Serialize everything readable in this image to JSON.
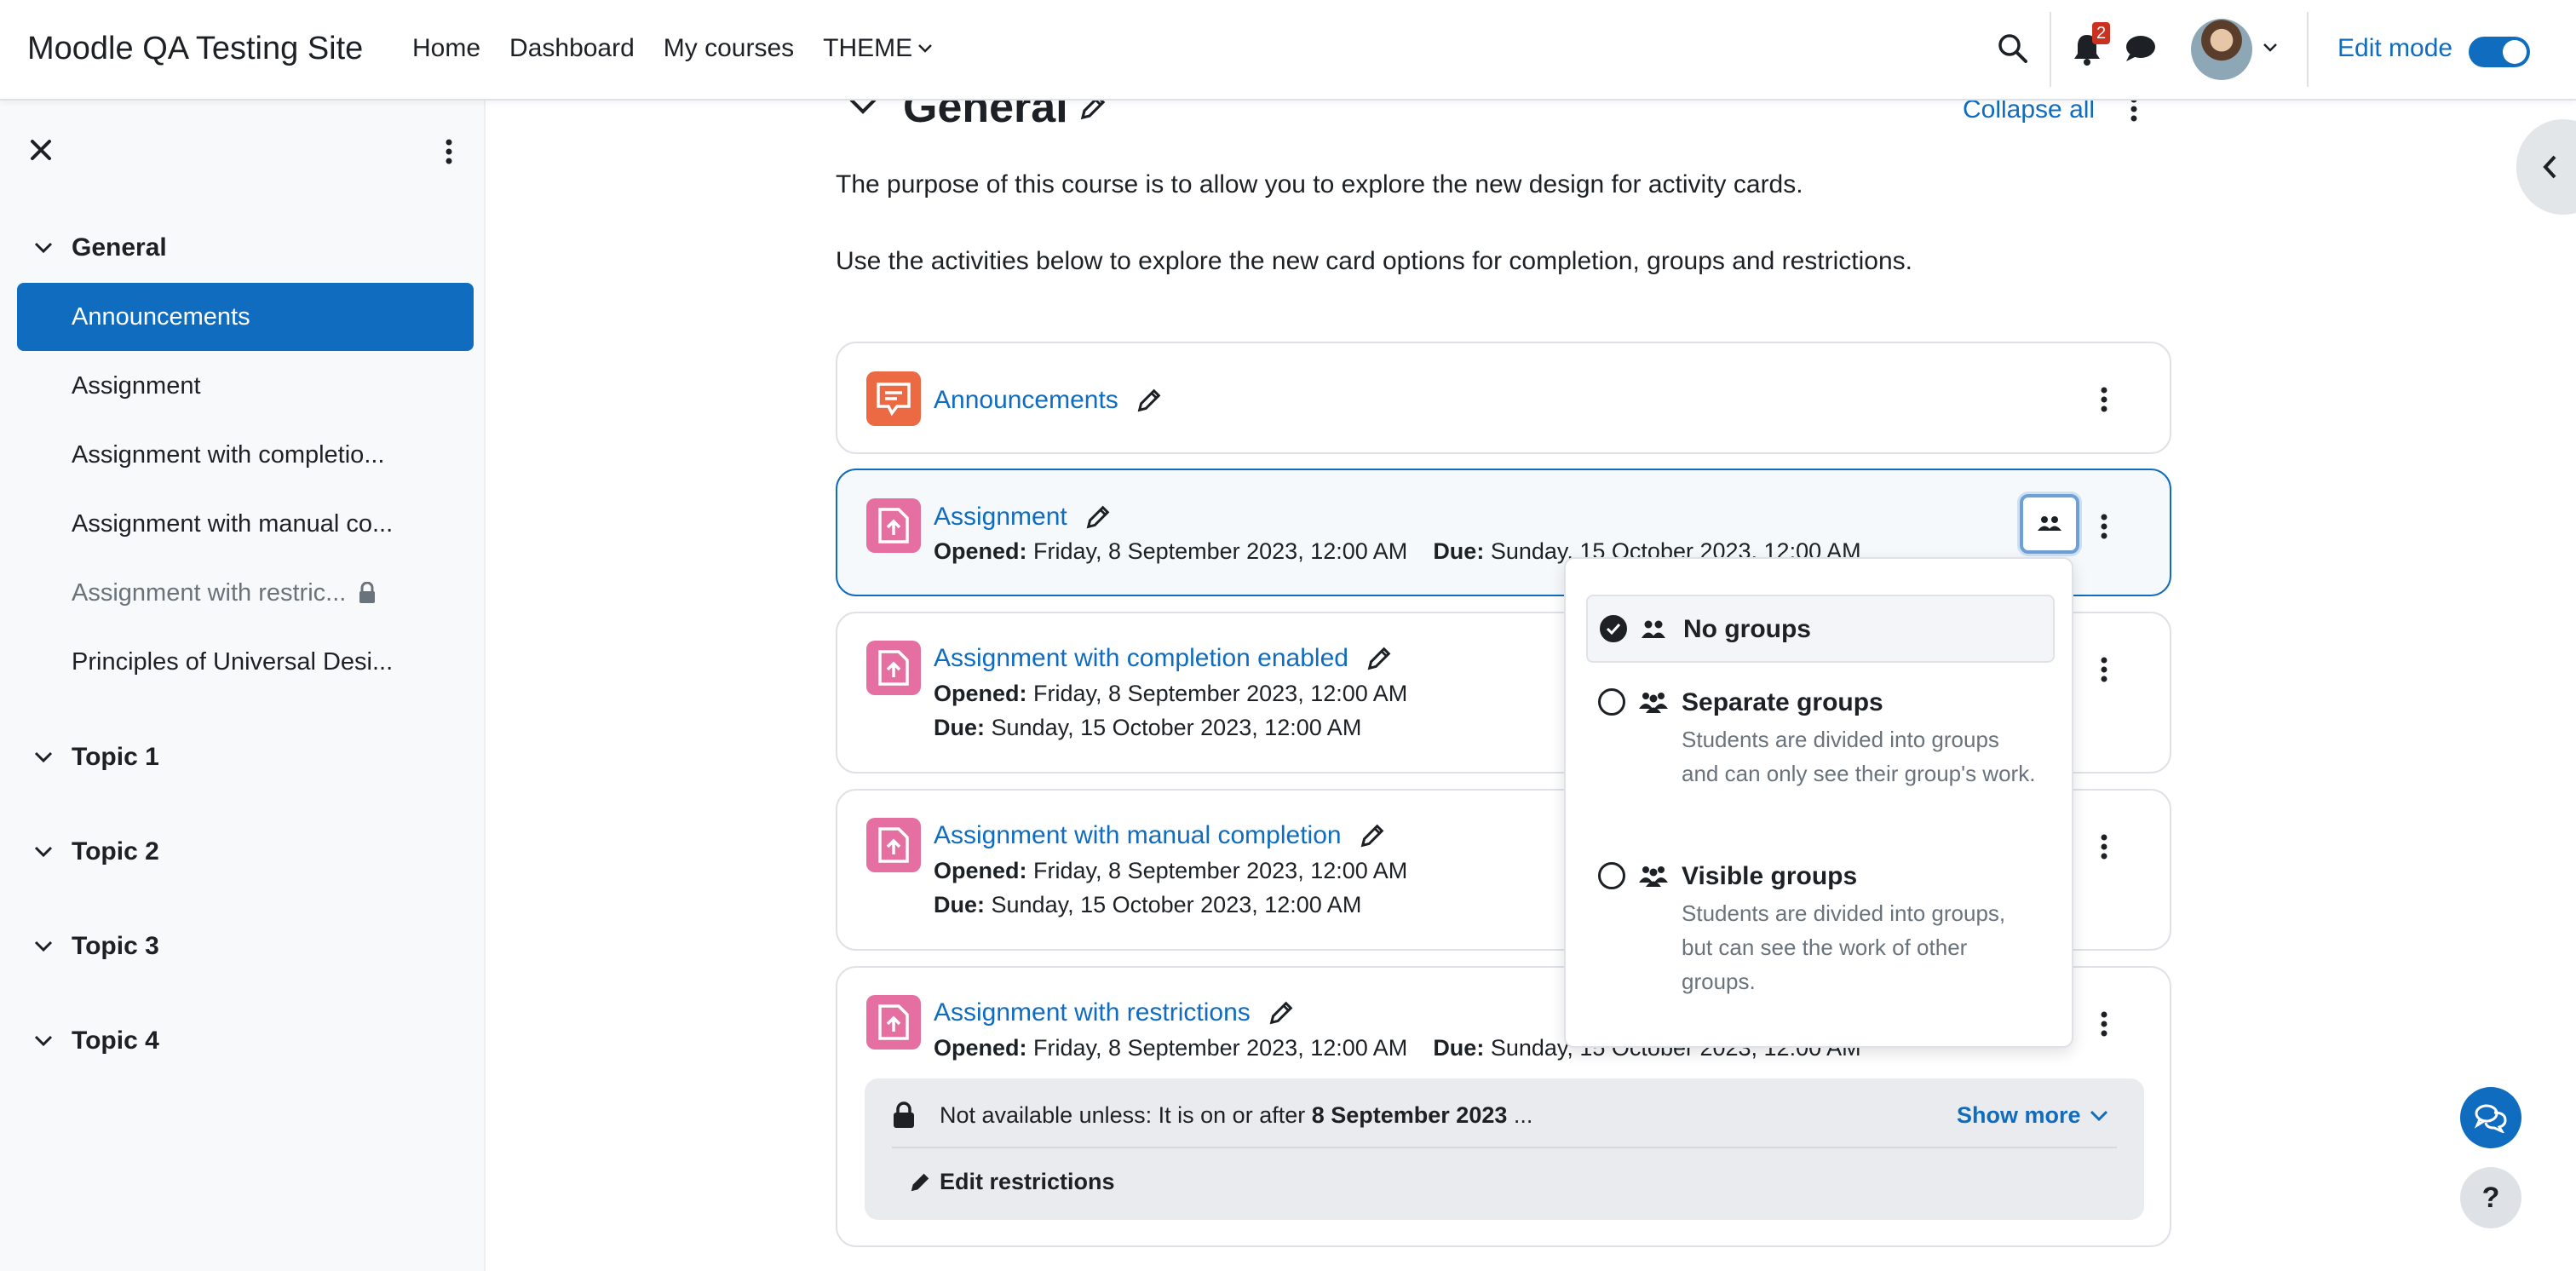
{
  "header": {
    "site_name": "Moodle QA Testing Site",
    "nav": [
      "Home",
      "Dashboard",
      "My courses",
      "THEME"
    ],
    "notification_count": "2",
    "edit_mode_label": "Edit mode",
    "edit_mode_on": true
  },
  "drawer": {
    "sections": [
      {
        "name": "General"
      },
      {
        "name": "Topic 1"
      },
      {
        "name": "Topic 2"
      },
      {
        "name": "Topic 3"
      },
      {
        "name": "Topic 4"
      }
    ],
    "items": [
      {
        "label": "Announcements",
        "active": true
      },
      {
        "label": "Assignment"
      },
      {
        "label": "Assignment with completio..."
      },
      {
        "label": "Assignment with manual co..."
      },
      {
        "label": "Assignment with restric...",
        "locked": true
      },
      {
        "label": "Principles of Universal Desi..."
      }
    ]
  },
  "section": {
    "title": "General",
    "collapse_all": "Collapse all",
    "summary": [
      "The purpose of this course is to allow you to explore the new design for activity cards.",
      "Use the activities below to explore the new card options for completion, groups and restrictions."
    ]
  },
  "labels": {
    "opened": "Opened:",
    "due": "Due:"
  },
  "activities": [
    {
      "name": "Announcements",
      "type": "forum"
    },
    {
      "name": "Assignment",
      "type": "assign",
      "opened": "Friday, 8 September 2023, 12:00 AM",
      "due": "Sunday, 15 October 2023, 12:00 AM"
    },
    {
      "name": "Assignment with completion enabled",
      "type": "assign",
      "opened": "Friday, 8 September 2023, 12:00 AM",
      "due": "Sunday, 15 October 2023, 12:00 AM"
    },
    {
      "name": "Assignment with manual completion",
      "type": "assign",
      "opened": "Friday, 8 September 2023, 12:00 AM",
      "due": "Sunday, 15 October 2023, 12:00 AM"
    },
    {
      "name": "Assignment with restrictions",
      "type": "assign",
      "opened": "Friday, 8 September 2023, 12:00 AM",
      "due": "Sunday, 15 October 2023, 12:00 AM"
    }
  ],
  "restriction": {
    "text_prefix": "Not available unless: It is on or after ",
    "text_date": "8 September 2023",
    "text_suffix": " ...",
    "show_more": "Show more",
    "edit": "Edit restrictions"
  },
  "group_menu": {
    "options": [
      {
        "name": "No groups",
        "selected": true
      },
      {
        "name": "Separate groups",
        "description": "Students are divided into groups and can only see their group's work."
      },
      {
        "name": "Visible groups",
        "description": "Students are divided into groups, but can see the work of other groups."
      }
    ]
  },
  "help_label": "?",
  "colors": {
    "brand": "#0f6cbf",
    "forum_icon": "#eb6a43",
    "assign_icon": "#e46fa0",
    "badge": "#ca3120"
  }
}
